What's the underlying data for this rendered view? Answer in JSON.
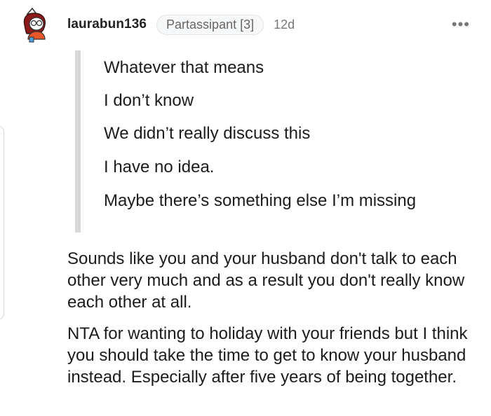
{
  "comment": {
    "username": "laurabun136",
    "flair": "Partassipant [3]",
    "age": "12d",
    "more_label": "•••",
    "quote_lines": [
      "Whatever that means",
      "I don’t know",
      "We didn’t really discuss this",
      "I have no idea.",
      "Maybe there’s something else I’m missing"
    ],
    "paragraphs": [
      "Sounds like you and your husband don't talk to each other very much and as a result you don't really know each other at all.",
      "NTA for wanting to holiday with your friends but I think you should take the time to get to know your husband instead. Especially after five years of being together."
    ]
  },
  "colors": {
    "quote_bar": "#d8d8d8",
    "avatar_hair": "#8b1a1a",
    "avatar_shirt": "#e8572a"
  }
}
